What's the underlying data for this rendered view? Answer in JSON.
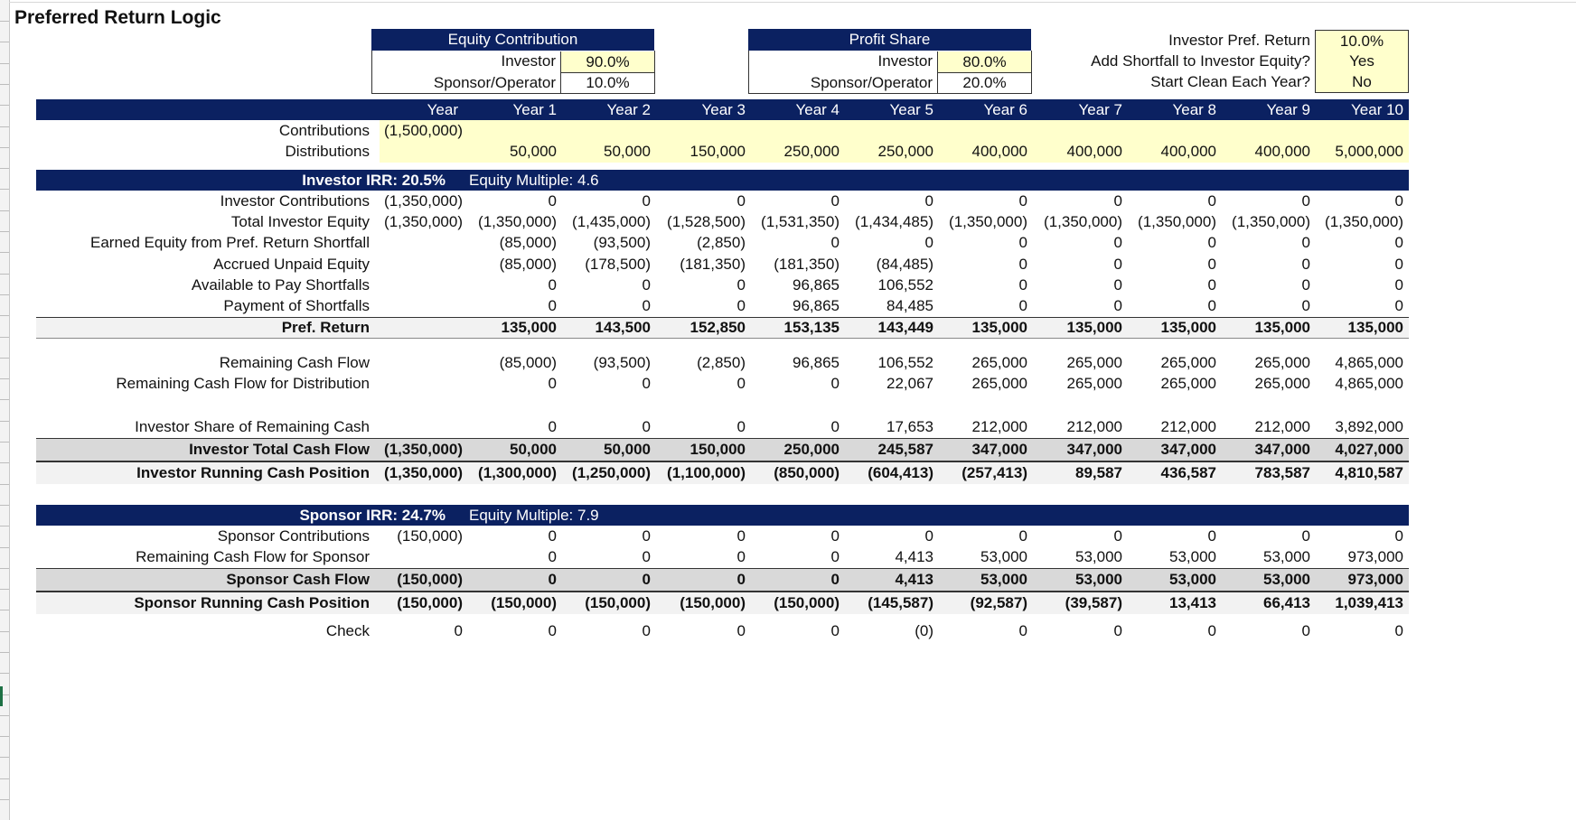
{
  "title": "Preferred Return Logic",
  "colors": {
    "navy": "#0b2161",
    "input_yellow": "#ffffcc",
    "band_gray": "#d9d9d9",
    "band_light": "#f2f2f2"
  },
  "equity_box": {
    "header": "Equity Contribution",
    "rows": [
      {
        "label": "Investor",
        "value": "90.0%"
      },
      {
        "label": "Sponsor/Operator",
        "value": "10.0%"
      }
    ]
  },
  "profit_box": {
    "header": "Profit Share",
    "rows": [
      {
        "label": "Investor",
        "value": "80.0%"
      },
      {
        "label": "Sponsor/Operator",
        "value": "20.0%"
      }
    ]
  },
  "settings": [
    {
      "label": "Investor Pref. Return",
      "value": "10.0%"
    },
    {
      "label": "Add Shortfall to Investor Equity?",
      "value": "Yes"
    },
    {
      "label": "Start Clean Each Year?",
      "value": "No"
    }
  ],
  "year_header": {
    "label": "Year",
    "years": [
      "Year 1",
      "Year 2",
      "Year 3",
      "Year 4",
      "Year 5",
      "Year 6",
      "Year 7",
      "Year 8",
      "Year 9",
      "Year 10"
    ]
  },
  "cashflow": [
    {
      "label": "Contributions",
      "y0": "(1,500,000)",
      "values": [
        "",
        "",
        "",
        "",
        "",
        "",
        "",
        "",
        "",
        ""
      ]
    },
    {
      "label": "Distributions",
      "y0": "",
      "values": [
        "50,000",
        "50,000",
        "150,000",
        "250,000",
        "250,000",
        "400,000",
        "400,000",
        "400,000",
        "400,000",
        "5,000,000"
      ]
    }
  ],
  "investor": {
    "irr": "Investor IRR: 20.5%",
    "multiple": "Equity Multiple: 4.6",
    "rows": [
      {
        "label": "Investor Contributions",
        "y0": "(1,350,000)",
        "values": [
          "0",
          "0",
          "0",
          "0",
          "0",
          "0",
          "0",
          "0",
          "0",
          "0"
        ]
      },
      {
        "label": "Total Investor Equity",
        "y0": "(1,350,000)",
        "values": [
          "(1,350,000)",
          "(1,435,000)",
          "(1,528,500)",
          "(1,531,350)",
          "(1,434,485)",
          "(1,350,000)",
          "(1,350,000)",
          "(1,350,000)",
          "(1,350,000)",
          "(1,350,000)"
        ]
      },
      {
        "label": "Earned Equity from Pref. Return Shortfall",
        "y0": "",
        "values": [
          "(85,000)",
          "(93,500)",
          "(2,850)",
          "0",
          "0",
          "0",
          "0",
          "0",
          "0",
          "0"
        ]
      },
      {
        "label": "Accrued Unpaid Equity",
        "y0": "",
        "values": [
          "(85,000)",
          "(178,500)",
          "(181,350)",
          "(181,350)",
          "(84,485)",
          "0",
          "0",
          "0",
          "0",
          "0"
        ]
      },
      {
        "label": "Available to Pay Shortfalls",
        "y0": "",
        "values": [
          "0",
          "0",
          "0",
          "96,865",
          "106,552",
          "0",
          "0",
          "0",
          "0",
          "0"
        ]
      },
      {
        "label": "Payment of Shortfalls",
        "y0": "",
        "values": [
          "0",
          "0",
          "0",
          "96,865",
          "84,485",
          "0",
          "0",
          "0",
          "0",
          "0"
        ]
      }
    ],
    "pref_return": {
      "label": "Pref. Return",
      "y0": "",
      "values": [
        "135,000",
        "143,500",
        "152,850",
        "153,135",
        "143,449",
        "135,000",
        "135,000",
        "135,000",
        "135,000",
        "135,000"
      ]
    },
    "remaining": [
      {
        "label": "Remaining Cash Flow",
        "y0": "",
        "values": [
          "(85,000)",
          "(93,500)",
          "(2,850)",
          "96,865",
          "106,552",
          "265,000",
          "265,000",
          "265,000",
          "265,000",
          "4,865,000"
        ]
      },
      {
        "label": "Remaining Cash Flow for Distribution",
        "y0": "",
        "values": [
          "0",
          "0",
          "0",
          "0",
          "22,067",
          "265,000",
          "265,000",
          "265,000",
          "265,000",
          "4,865,000"
        ]
      }
    ],
    "share": {
      "label": "Investor Share of Remaining Cash",
      "y0": "",
      "values": [
        "0",
        "0",
        "0",
        "0",
        "17,653",
        "212,000",
        "212,000",
        "212,000",
        "212,000",
        "3,892,000"
      ]
    },
    "total": {
      "label": "Investor Total Cash Flow",
      "y0": "(1,350,000)",
      "values": [
        "50,000",
        "50,000",
        "150,000",
        "250,000",
        "245,587",
        "347,000",
        "347,000",
        "347,000",
        "347,000",
        "4,027,000"
      ]
    },
    "running": {
      "label": "Investor Running Cash Position",
      "y0": "(1,350,000)",
      "values": [
        "(1,300,000)",
        "(1,250,000)",
        "(1,100,000)",
        "(850,000)",
        "(604,413)",
        "(257,413)",
        "89,587",
        "436,587",
        "783,587",
        "4,810,587"
      ]
    }
  },
  "sponsor": {
    "irr": "Sponsor IRR: 24.7%",
    "multiple": "Equity Multiple: 7.9",
    "rows": [
      {
        "label": "Sponsor Contributions",
        "y0": "(150,000)",
        "values": [
          "0",
          "0",
          "0",
          "0",
          "0",
          "0",
          "0",
          "0",
          "0",
          "0"
        ]
      },
      {
        "label": "Remaining Cash Flow for Sponsor",
        "y0": "",
        "values": [
          "0",
          "0",
          "0",
          "0",
          "4,413",
          "53,000",
          "53,000",
          "53,000",
          "53,000",
          "973,000"
        ]
      }
    ],
    "total": {
      "label": "Sponsor Cash Flow",
      "y0": "(150,000)",
      "values": [
        "0",
        "0",
        "0",
        "0",
        "4,413",
        "53,000",
        "53,000",
        "53,000",
        "53,000",
        "973,000"
      ]
    },
    "running": {
      "label": "Sponsor Running Cash Position",
      "y0": "(150,000)",
      "values": [
        "(150,000)",
        "(150,000)",
        "(150,000)",
        "(150,000)",
        "(145,587)",
        "(92,587)",
        "(39,587)",
        "13,413",
        "66,413",
        "1,039,413"
      ]
    }
  },
  "check": {
    "label": "Check",
    "y0": "0",
    "values": [
      "0",
      "0",
      "0",
      "0",
      "(0)",
      "0",
      "0",
      "0",
      "0",
      "0"
    ]
  }
}
